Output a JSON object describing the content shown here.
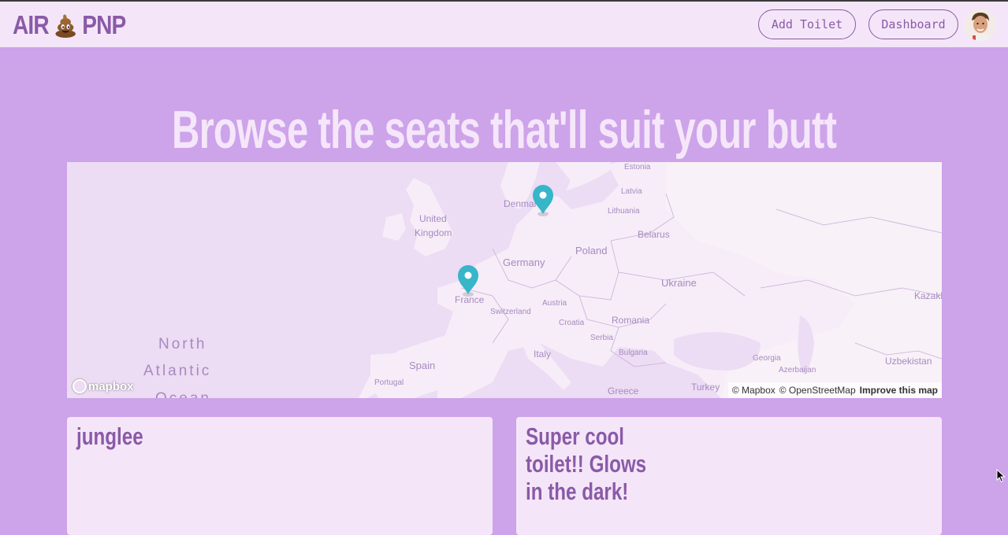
{
  "navbar": {
    "logo_left": "AIR",
    "logo_right": "PNP",
    "add_toilet_label": "Add Toilet",
    "dashboard_label": "Dashboard"
  },
  "hero": {
    "title": "Browse the seats that'll suit your butt"
  },
  "map": {
    "labels": {
      "estonia": "Estonia",
      "latvia": "Latvia",
      "lithuania": "Lithuania",
      "denmark": "Denmark",
      "united": "United",
      "kingdom": "Kingdom",
      "belarus": "Belarus",
      "poland": "Poland",
      "germany": "Germany",
      "ukraine": "Ukraine",
      "france": "France",
      "austria": "Austria",
      "switzerland": "Switzerland",
      "romania": "Romania",
      "croatia": "Croatia",
      "serbia": "Serbia",
      "italy": "Italy",
      "bulgaria": "Bulgaria",
      "georgia": "Georgia",
      "azerbaijan": "Azerbaijan",
      "uzbekistan": "Uzbekistan",
      "kazakh": "Kazakh",
      "spain": "Spain",
      "portugal": "Portugal",
      "greece": "Greece",
      "turkey": "Turkey",
      "north": "North",
      "atlantic": "Atlantic",
      "ocean": "Ocean"
    },
    "mapbox_logo": "mapbox",
    "attribution_mapbox": "© Mapbox",
    "attribution_osm": "© OpenStreetMap",
    "improve_link": "Improve this map",
    "marker_color": "#37b5c9"
  },
  "listings": [
    {
      "title": "junglee"
    },
    {
      "title": "Super cool toilet!! Glows in the dark!"
    }
  ],
  "colors": {
    "background": "#cda3ea",
    "surface": "#f4e6f8",
    "accent": "#8a5aa8"
  }
}
